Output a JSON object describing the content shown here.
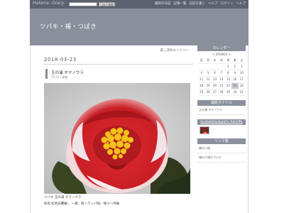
{
  "topbar": {
    "logo": "Hatena::Diary",
    "search_placeholder": "",
    "btn_search": "日記",
    "btn_search2": "検索",
    "links": [
      "最新の日記",
      "記事一覧",
      "日記を書く",
      "ヘルプ",
      "ログイン",
      "ヘルプ"
    ]
  },
  "header": {
    "title": "ツバキ・椿・つばき"
  },
  "main": {
    "subnav": "前 | 次のエントリー",
    "date": "2018-03-23",
    "entry_title": "玉の浦  タマノウラ",
    "entry_meta": "14:03 | 編集",
    "caption1": "ツバキ  玉の浦  タマノウラ",
    "caption2": "別名'紅地白覆輪'、一重、筒～ラッパ咲、極小～中輪"
  },
  "sidebar": {
    "calendar_title": "カレンダー",
    "calendar_month": "< 2018/03 >",
    "dow": [
      "日",
      "月",
      "火",
      "水",
      "木",
      "金",
      "土"
    ],
    "weeks": [
      [
        "",
        "",
        "",
        "",
        "1",
        "2",
        "3"
      ],
      [
        "4",
        "5",
        "6",
        "7",
        "8",
        "9",
        "10"
      ],
      [
        "11",
        "12",
        "13",
        "14",
        "15",
        "16",
        "17"
      ],
      [
        "18",
        "19",
        "20",
        "21",
        "22",
        "23",
        "24"
      ],
      [
        "25",
        "26",
        "27",
        "28",
        "29",
        "30",
        "31"
      ]
    ],
    "latest_title": "最新タイトル",
    "latest_item": "玉の浦  タマノウラ",
    "user_title": "tsubakitsubaki's fotolife",
    "link_title": "リンク集",
    "links": [
      "椿の小道",
      "椿の小道のブログ"
    ]
  },
  "colors": {
    "topbar": "#5d6270",
    "header": "#8a8f9c",
    "flower_red": "#d8242b",
    "stamens": "#f2c21a"
  }
}
